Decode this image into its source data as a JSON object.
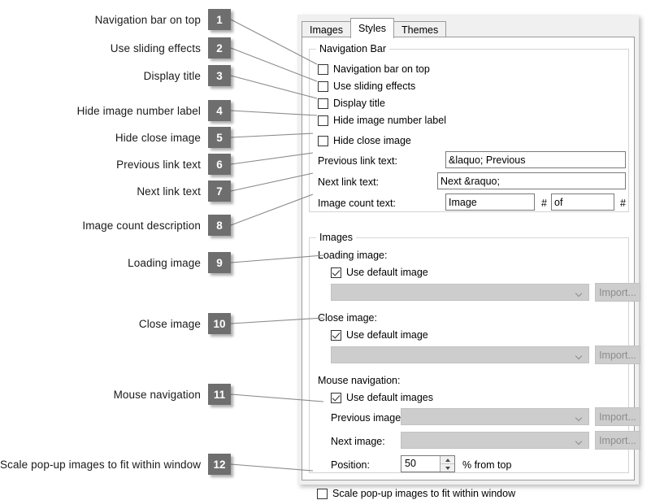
{
  "annotations": [
    {
      "num": "1",
      "label": "Navigation bar on top"
    },
    {
      "num": "2",
      "label": "Use sliding effects"
    },
    {
      "num": "3",
      "label": "Display title"
    },
    {
      "num": "4",
      "label": "Hide image number label"
    },
    {
      "num": "5",
      "label": "Hide close image"
    },
    {
      "num": "6",
      "label": "Previous link text"
    },
    {
      "num": "7",
      "label": "Next link text"
    },
    {
      "num": "8",
      "label": "Image count description"
    },
    {
      "num": "9",
      "label": "Loading image"
    },
    {
      "num": "10",
      "label": "Close image"
    },
    {
      "num": "11",
      "label": "Mouse navigation"
    },
    {
      "num": "12",
      "label": "Scale pop-up images to fit within window"
    }
  ],
  "dialog": {
    "tabs": [
      {
        "label": "Images",
        "active": false
      },
      {
        "label": "Styles",
        "active": true
      },
      {
        "label": "Themes",
        "active": false
      }
    ],
    "navigation_bar": {
      "title": "Navigation Bar",
      "checkboxes": [
        {
          "label": "Navigation bar on top",
          "checked": false
        },
        {
          "label": "Use sliding effects",
          "checked": false
        },
        {
          "label": "Display title",
          "checked": false
        },
        {
          "label": "Hide image number label",
          "checked": false
        },
        {
          "label": "Hide close image",
          "checked": false
        }
      ],
      "previous_link": {
        "label": "Previous link text:",
        "value": "&laquo; Previous"
      },
      "next_link": {
        "label": "Next link text:",
        "value": "Next &raquo;"
      },
      "image_count": {
        "label": "Image count text:",
        "value_1": "Image",
        "hash_1": "#",
        "value_2": "of",
        "hash_2": "#"
      }
    },
    "images": {
      "title": "Images",
      "loading_image": {
        "label": "Loading image:",
        "use_default_label": "Use default image",
        "use_default_checked": true,
        "combo_value": "",
        "import_label": "Import..."
      },
      "close_image": {
        "label": "Close image:",
        "use_default_label": "Use default image",
        "use_default_checked": true,
        "combo_value": "",
        "import_label": "Import..."
      },
      "mouse_navigation": {
        "label": "Mouse navigation:",
        "use_default_label": "Use default images",
        "use_default_checked": true,
        "previous_image": {
          "label": "Previous image:",
          "combo_value": "",
          "import_label": "Import..."
        },
        "next_image": {
          "label": "Next image:",
          "combo_value": "",
          "import_label": "Import..."
        },
        "position": {
          "label": "Position:",
          "value": "50",
          "suffix": "% from top"
        }
      },
      "scale_popup": {
        "label": "Scale pop-up images to fit within window",
        "checked": false
      }
    }
  },
  "colors": {
    "badge_bg": "#6e6e6e",
    "dialog_bg": "#f0f0f0",
    "tabpage_bg": "#ffffff",
    "leader_line": "#8a8a8a",
    "group_border": "#d4d4d4",
    "disabled_control": "#cdcdcd"
  }
}
